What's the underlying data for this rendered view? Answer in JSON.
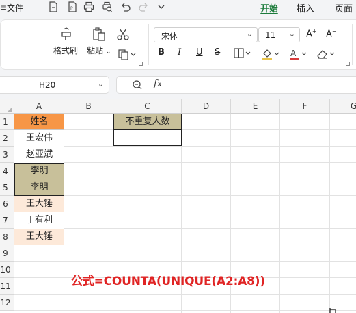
{
  "menubar": {
    "file_label": "文件",
    "tabs": [
      "开始",
      "插入",
      "页面"
    ],
    "active_tab": "开始"
  },
  "ribbon": {
    "format_painter": "格式刷",
    "paste": "粘贴",
    "font_name": "宋体",
    "font_size": "11"
  },
  "formula_bar": {
    "name_box": "H20",
    "fx_label": "fx",
    "formula": ""
  },
  "sheet": {
    "columns": [
      "A",
      "B",
      "C",
      "D",
      "E",
      "F",
      "G"
    ],
    "rows": [
      "1",
      "2",
      "3",
      "4",
      "5",
      "6",
      "7",
      "8",
      "9",
      "10",
      "11",
      "12"
    ],
    "cells": {
      "A1": "姓名",
      "A2": "王宏伟",
      "A3": "赵亚斌",
      "A4": "李明",
      "A5": "李明",
      "A6": "王大锤",
      "A7": "丁有利",
      "A8": "王大锤",
      "C1": "不重复人数",
      "C2": ""
    },
    "colors": {
      "header_orange": "#f79646",
      "dup_olive": "#c8c09a",
      "dup_peach": "#fde9d9",
      "note_red": "#e02424"
    }
  },
  "annotation": "公式=COUNTA(UNIQUE(A2:A8))"
}
